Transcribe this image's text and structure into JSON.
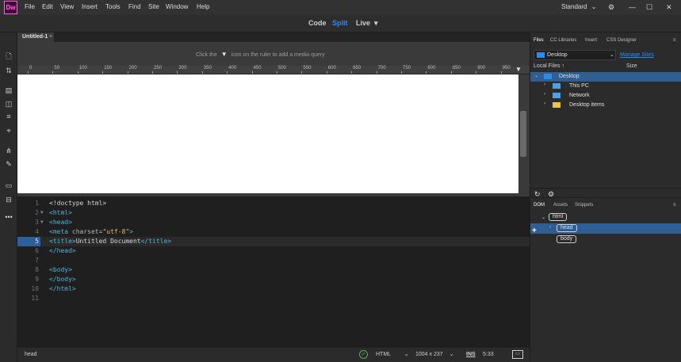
{
  "app": {
    "logo": "Dw",
    "menu": [
      "File",
      "Edit",
      "View",
      "Insert",
      "Tools",
      "Find",
      "Site",
      "Window",
      "Help"
    ],
    "workspace": "Standard",
    "workspace_chevron": "⌄"
  },
  "views": {
    "code": "Code",
    "split": "Split",
    "live": "Live",
    "live_chevron": "▾"
  },
  "document": {
    "tab_title": "Untitled-1",
    "tab_close": "×",
    "media_query_hint_before": "Click the",
    "media_query_hint_after": "icon on the ruler to add a media query"
  },
  "ruler": {
    "ticks": [
      "0",
      "50",
      "100",
      "150",
      "200",
      "250",
      "300",
      "350",
      "400",
      "450",
      "500",
      "550",
      "600",
      "650",
      "700",
      "750",
      "800",
      "850",
      "900",
      "950"
    ]
  },
  "code": {
    "current_line": 5,
    "lines": [
      {
        "n": "1",
        "fold": "",
        "tokens": [
          {
            "t": "<!doctype html>",
            "c": "c-plain"
          }
        ]
      },
      {
        "n": "2",
        "fold": "▼",
        "tokens": [
          {
            "t": "<html>",
            "c": "c-tag"
          }
        ]
      },
      {
        "n": "3",
        "fold": "▼",
        "tokens": [
          {
            "t": "<head>",
            "c": "c-tag"
          }
        ]
      },
      {
        "n": "4",
        "fold": "",
        "tokens": [
          {
            "t": "<meta ",
            "c": "c-tag"
          },
          {
            "t": "charset=",
            "c": "c-attr"
          },
          {
            "t": "\"utf-8\"",
            "c": "c-val"
          },
          {
            "t": ">",
            "c": "c-tag"
          }
        ]
      },
      {
        "n": "5",
        "fold": "",
        "tokens": [
          {
            "t": "<title>",
            "c": "c-tag"
          },
          {
            "t": "Untitled Document",
            "c": "c-plain"
          },
          {
            "t": "</title>",
            "c": "c-tag"
          }
        ]
      },
      {
        "n": "6",
        "fold": "",
        "tokens": [
          {
            "t": "</head>",
            "c": "c-tag"
          }
        ]
      },
      {
        "n": "7",
        "fold": "",
        "tokens": []
      },
      {
        "n": "8",
        "fold": "",
        "tokens": [
          {
            "t": "<body>",
            "c": "c-tag"
          }
        ]
      },
      {
        "n": "9",
        "fold": "",
        "tokens": [
          {
            "t": "</body>",
            "c": "c-tag"
          }
        ]
      },
      {
        "n": "10",
        "fold": "",
        "tokens": [
          {
            "t": "</html>",
            "c": "c-tag"
          }
        ]
      },
      {
        "n": "11",
        "fold": "",
        "tokens": []
      }
    ]
  },
  "status": {
    "tag": "head",
    "language": "HTML",
    "language_chevron": "⌄",
    "window_size": "1004 x 237",
    "window_size_chevron": "⌄",
    "mode": "INS",
    "position": "5:33"
  },
  "files_panel": {
    "tabs": [
      "Files",
      "CC Libraries",
      "Insert",
      "CSS Designer"
    ],
    "site": "Desktop",
    "manage_sites": "Manage Sites",
    "col_local": "Local Files ↑",
    "col_size": "Size",
    "items": [
      {
        "label": "Desktop",
        "arrow": "⌄",
        "icon": "desktop-folder-icon"
      },
      {
        "label": "This PC",
        "arrow": "›",
        "icon": "computer-icon"
      },
      {
        "label": "Network",
        "arrow": "›",
        "icon": "network-icon"
      },
      {
        "label": "Desktop items",
        "arrow": "›",
        "icon": "folder-icon"
      }
    ]
  },
  "dom_panel": {
    "tabs": [
      "DOM",
      "Assets",
      "Snippets"
    ],
    "nodes": [
      "html",
      "head",
      "body"
    ]
  },
  "colors": {
    "accent": "#2d8ceb",
    "selection": "#2f5e93",
    "logo_bg": "#470137",
    "logo_fg": "#ff61f6"
  }
}
